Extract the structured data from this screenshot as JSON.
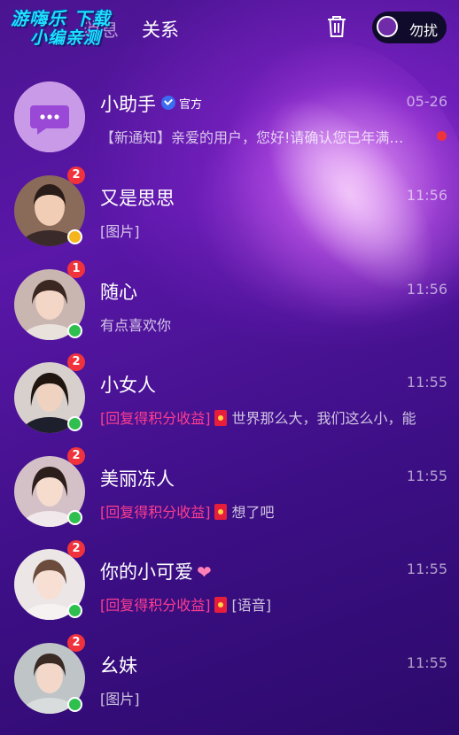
{
  "watermark": {
    "line1": "游嗨乐 下载",
    "line2": "小编亲测"
  },
  "header": {
    "tab_messages": "消息",
    "tab_relations": "关系",
    "dnd_label": "勿扰"
  },
  "colors": {
    "online": "#2fbf4f",
    "away": "#f5b51e",
    "badge": "#f0323c",
    "reward": "#ff3d8f"
  },
  "conversations": [
    {
      "name": "小助手",
      "official": "官方",
      "time": "05-26",
      "preview": "【新通知】亲爱的用户，您好!请确认您已年满…",
      "unread_dot": true,
      "avatar_icon": "chat-bubble-icon"
    },
    {
      "name": "又是思思",
      "time": "11:56",
      "badge": "2",
      "status": "away",
      "preview": "[图片]"
    },
    {
      "name": "随心",
      "time": "11:56",
      "badge": "1",
      "status": "online",
      "preview": "有点喜欢你"
    },
    {
      "name": "小女人",
      "time": "11:55",
      "badge": "2",
      "status": "online",
      "reward": "[回复得积分收益]",
      "preview": "世界那么大，我们这么小，能"
    },
    {
      "name": "美丽冻人",
      "time": "11:55",
      "badge": "2",
      "status": "online",
      "reward": "[回复得积分收益]",
      "preview": "想了吧"
    },
    {
      "name": "你的小可爱",
      "time": "11:55",
      "badge": "2",
      "status": "online",
      "reward": "[回复得积分收益]",
      "preview": "[语音]",
      "heart": "❤"
    },
    {
      "name": "幺妹",
      "time": "11:55",
      "badge": "2",
      "status": "online",
      "preview": "[图片]"
    }
  ]
}
